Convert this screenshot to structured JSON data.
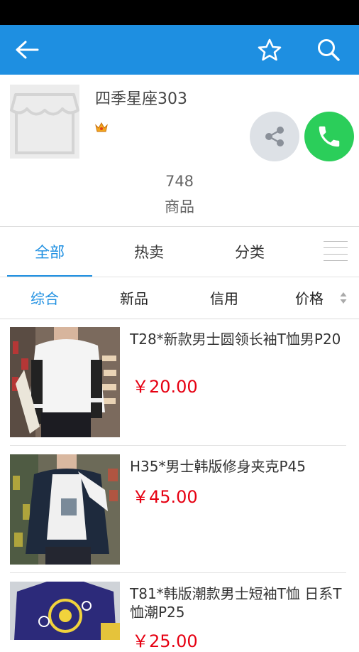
{
  "shop": {
    "name": "四季星座303",
    "product_count": "748",
    "product_count_label": "商品"
  },
  "tabs": [
    {
      "label": "全部",
      "active": true
    },
    {
      "label": "热卖",
      "active": false
    },
    {
      "label": "分类",
      "active": false
    }
  ],
  "sort": [
    {
      "label": "综合",
      "active": true
    },
    {
      "label": "新品",
      "active": false
    },
    {
      "label": "信用",
      "active": false
    },
    {
      "label": "价格",
      "active": false
    }
  ],
  "products": [
    {
      "title": "T28*新款男士圆领长袖T恤男P20",
      "price": "￥20.00"
    },
    {
      "title": "H35*男士韩版修身夹克P45",
      "price": "￥45.00"
    },
    {
      "title": "T81*韩版潮款男士短袖T恤 日系T恤潮P25",
      "price": "￥25.00"
    }
  ],
  "colors": {
    "accent": "#1e8fe1",
    "price": "#e60012",
    "call": "#2bce5a"
  }
}
